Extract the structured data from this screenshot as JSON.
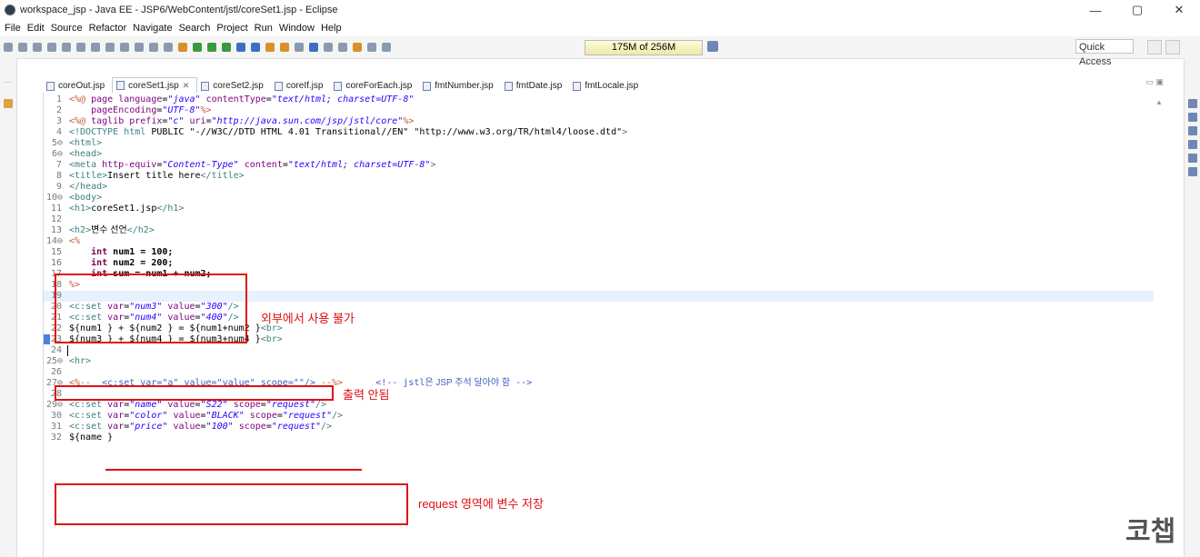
{
  "window": {
    "title": "workspace_jsp - Java EE - JSP6/WebContent/jstl/coreSet1.jsp - Eclipse",
    "controls": [
      "—",
      "▢",
      "✕"
    ]
  },
  "menu": [
    "File",
    "Edit",
    "Source",
    "Refactor",
    "Navigate",
    "Search",
    "Project",
    "Run",
    "Window",
    "Help"
  ],
  "toolbar": {
    "heap": "175M of 256M",
    "quick_access": "Quick Access"
  },
  "tabs": [
    {
      "label": "coreOut.jsp",
      "active": false
    },
    {
      "label": "coreSet1.jsp",
      "active": true
    },
    {
      "label": "coreSet2.jsp",
      "active": false
    },
    {
      "label": "coreIf.jsp",
      "active": false
    },
    {
      "label": "coreForEach.jsp",
      "active": false
    },
    {
      "label": "fmtNumber.jsp",
      "active": false
    },
    {
      "label": "fmtDate.jsp",
      "active": false
    },
    {
      "label": "fmtLocale.jsp",
      "active": false
    }
  ],
  "editor": {
    "lines": [
      {
        "n": "1",
        "fold": false,
        "t": [
          [
            "dir",
            "<%@ "
          ],
          [
            "at",
            "page "
          ],
          [
            "at",
            "language"
          ],
          [
            "tx",
            "="
          ],
          [
            "sv",
            "\"java\""
          ],
          [
            "tx",
            " "
          ],
          [
            "at",
            "contentType"
          ],
          [
            "tx",
            "="
          ],
          [
            "sv",
            "\"text/html; charset=UTF-8\""
          ]
        ]
      },
      {
        "n": "2",
        "fold": false,
        "t": [
          [
            "tx",
            "    "
          ],
          [
            "at",
            "pageEncoding"
          ],
          [
            "tx",
            "="
          ],
          [
            "sv",
            "\"UTF-8\""
          ],
          [
            "dir",
            "%>"
          ]
        ]
      },
      {
        "n": "3",
        "fold": false,
        "t": [
          [
            "dir",
            "<%@ "
          ],
          [
            "at",
            "taglib "
          ],
          [
            "at",
            "prefix"
          ],
          [
            "tx",
            "="
          ],
          [
            "sv",
            "\"c\""
          ],
          [
            "tx",
            " "
          ],
          [
            "at",
            "uri"
          ],
          [
            "tx",
            "="
          ],
          [
            "sv",
            "\"http://java.sun.com/jsp/jstl/core\""
          ],
          [
            "dir",
            "%>"
          ]
        ]
      },
      {
        "n": "4",
        "fold": false,
        "t": [
          [
            "tag",
            "<!DOCTYPE "
          ],
          [
            "tag",
            "html"
          ],
          [
            "tx",
            " PUBLIC "
          ],
          [
            "sv2",
            "\"-//W3C//DTD HTML 4.01 Transitional//EN\""
          ],
          [
            "tx",
            " "
          ],
          [
            "sv2",
            "\"http://www.w3.org/TR/html4/loose.dtd\""
          ],
          [
            "tag",
            ">"
          ]
        ]
      },
      {
        "n": "5",
        "fold": true,
        "t": [
          [
            "tag",
            "<html>"
          ]
        ]
      },
      {
        "n": "6",
        "fold": true,
        "t": [
          [
            "tag",
            "<head>"
          ]
        ]
      },
      {
        "n": "7",
        "fold": false,
        "t": [
          [
            "tag",
            "<meta "
          ],
          [
            "at",
            "http-equiv"
          ],
          [
            "tx",
            "="
          ],
          [
            "sv",
            "\"Content-Type\""
          ],
          [
            "tx",
            " "
          ],
          [
            "at",
            "content"
          ],
          [
            "tx",
            "="
          ],
          [
            "sv",
            "\"text/html; charset=UTF-8\""
          ],
          [
            "tag",
            ">"
          ]
        ]
      },
      {
        "n": "8",
        "fold": false,
        "t": [
          [
            "tag",
            "<title>"
          ],
          [
            "ht",
            "Insert title here"
          ],
          [
            "tag",
            "</title>"
          ]
        ]
      },
      {
        "n": "9",
        "fold": false,
        "t": [
          [
            "tag",
            "</head>"
          ]
        ]
      },
      {
        "n": "10",
        "fold": true,
        "t": [
          [
            "tag",
            "<body>"
          ]
        ]
      },
      {
        "n": "11",
        "fold": false,
        "t": [
          [
            "tag",
            "<h1>"
          ],
          [
            "ht",
            "coreSet1.jsp"
          ],
          [
            "tag",
            "</h1>"
          ]
        ]
      },
      {
        "n": "12",
        "fold": false,
        "t": []
      },
      {
        "n": "13",
        "fold": false,
        "t": [
          [
            "tag",
            "<h2>"
          ],
          [
            "kr",
            "변수 선언"
          ],
          [
            "tag",
            "</h2>"
          ]
        ]
      },
      {
        "n": "14",
        "fold": true,
        "t": [
          [
            "dir",
            "<%"
          ]
        ]
      },
      {
        "n": "15",
        "fold": false,
        "t": [
          [
            "tx",
            "    "
          ],
          [
            "jk",
            "int"
          ],
          [
            "js",
            " num1 = 100;"
          ]
        ]
      },
      {
        "n": "16",
        "fold": false,
        "t": [
          [
            "tx",
            "    "
          ],
          [
            "jk",
            "int"
          ],
          [
            "js",
            " num2 = 200;"
          ]
        ]
      },
      {
        "n": "17",
        "fold": false,
        "t": [
          [
            "tx",
            "    "
          ],
          [
            "jk",
            "int"
          ],
          [
            "js",
            " sum = num1 + num2;"
          ]
        ]
      },
      {
        "n": "18",
        "fold": false,
        "t": [
          [
            "dir",
            "%>"
          ]
        ]
      },
      {
        "n": "19",
        "fold": false,
        "cur": true,
        "t": []
      },
      {
        "n": "20",
        "fold": false,
        "t": [
          [
            "tag",
            "<c:set "
          ],
          [
            "at",
            "var"
          ],
          [
            "tx",
            "="
          ],
          [
            "sv",
            "\"num3\""
          ],
          [
            "tx",
            " "
          ],
          [
            "at",
            "value"
          ],
          [
            "tx",
            "="
          ],
          [
            "sv",
            "\"300\""
          ],
          [
            "tag",
            "/>"
          ]
        ]
      },
      {
        "n": "21",
        "fold": false,
        "t": [
          [
            "tag",
            "<c:set "
          ],
          [
            "at",
            "var"
          ],
          [
            "tx",
            "="
          ],
          [
            "sv",
            "\"num4\""
          ],
          [
            "tx",
            " "
          ],
          [
            "at",
            "value"
          ],
          [
            "tx",
            "="
          ],
          [
            "sv",
            "\"400\""
          ],
          [
            "tag",
            "/>"
          ]
        ]
      },
      {
        "n": "22",
        "fold": false,
        "t": [
          [
            "el",
            "${num1 } + ${num2 } = ${num1+num2 }"
          ],
          [
            "tag",
            "<br>"
          ]
        ]
      },
      {
        "n": "23",
        "fold": false,
        "t": [
          [
            "el",
            "${num3 } + ${num4 } = ${num3+num4 }"
          ],
          [
            "tag",
            "<br>"
          ]
        ]
      },
      {
        "n": "24",
        "fold": false,
        "t": []
      },
      {
        "n": "25",
        "fold": true,
        "t": [
          [
            "tag",
            "<hr>"
          ]
        ]
      },
      {
        "n": "26",
        "fold": false,
        "t": []
      },
      {
        "n": "27",
        "fold": true,
        "t": [
          [
            "dir",
            "<%-- "
          ],
          [
            "cm",
            " <c:set var=\"a\" value=\"value\" scope=\"\"/> "
          ],
          [
            "dir",
            "--%>"
          ],
          [
            "tx",
            "      "
          ],
          [
            "cm",
            "<!-- "
          ],
          [
            "cm",
            "jstl"
          ],
          [
            "kr2",
            "은 JSP 주석 달아야 함"
          ],
          [
            "cm",
            " -->"
          ]
        ]
      },
      {
        "n": "28",
        "fold": false,
        "t": []
      },
      {
        "n": "29",
        "fold": true,
        "t": [
          [
            "tag",
            "<c:set "
          ],
          [
            "at",
            "var"
          ],
          [
            "tx",
            "="
          ],
          [
            "sv",
            "\"name\""
          ],
          [
            "tx",
            " "
          ],
          [
            "at",
            "value"
          ],
          [
            "tx",
            "="
          ],
          [
            "sv",
            "\"S22\""
          ],
          [
            "tx",
            " "
          ],
          [
            "at",
            "scope"
          ],
          [
            "tx",
            "="
          ],
          [
            "sv",
            "\"request\""
          ],
          [
            "tag",
            "/>"
          ]
        ]
      },
      {
        "n": "30",
        "fold": false,
        "t": [
          [
            "tag",
            "<c:set "
          ],
          [
            "at",
            "var"
          ],
          [
            "tx",
            "="
          ],
          [
            "sv",
            "\"color\""
          ],
          [
            "tx",
            " "
          ],
          [
            "at",
            "value"
          ],
          [
            "tx",
            "="
          ],
          [
            "sv",
            "\"BLACK\""
          ],
          [
            "tx",
            " "
          ],
          [
            "at",
            "scope"
          ],
          [
            "tx",
            "="
          ],
          [
            "sv",
            "\"request\""
          ],
          [
            "tag",
            "/>"
          ]
        ]
      },
      {
        "n": "31",
        "fold": false,
        "t": [
          [
            "tag",
            "<c:set "
          ],
          [
            "at",
            "var"
          ],
          [
            "tx",
            "="
          ],
          [
            "sv",
            "\"price\""
          ],
          [
            "tx",
            " "
          ],
          [
            "at",
            "value"
          ],
          [
            "tx",
            "="
          ],
          [
            "sv",
            "\"100\""
          ],
          [
            "tx",
            " "
          ],
          [
            "at",
            "scope"
          ],
          [
            "tx",
            "="
          ],
          [
            "sv",
            "\"request\""
          ],
          [
            "tag",
            "/>"
          ]
        ]
      },
      {
        "n": "32",
        "fold": false,
        "t": [
          [
            "el",
            "${name }"
          ]
        ]
      }
    ]
  },
  "annotations": {
    "not_usable_outside": "외부에서 사용 불가",
    "no_output": "출력 안됨",
    "store_in_request": "request 영역에 변수 저장"
  },
  "watermark": "코챕",
  "colors": {
    "annotation_red": "#e01010",
    "current_line": "#e8f2fe",
    "jsp_tag": "#3f7f7f",
    "attr_name": "#7f007f",
    "attr_value": "#2a00ff"
  }
}
